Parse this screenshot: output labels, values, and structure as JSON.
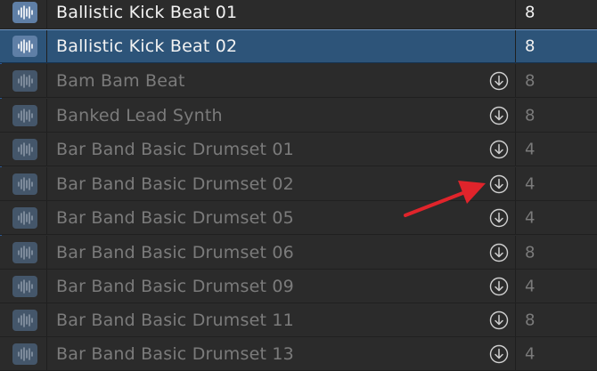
{
  "rows": [
    {
      "name": "Ballistic Kick Beat 01",
      "count": "8",
      "state": "installed",
      "selected": false
    },
    {
      "name": "Ballistic Kick Beat 02",
      "count": "8",
      "state": "installed",
      "selected": true
    },
    {
      "name": "Bam Bam Beat",
      "count": "8",
      "state": "missing",
      "selected": false
    },
    {
      "name": "Banked Lead Synth",
      "count": "8",
      "state": "missing",
      "selected": false
    },
    {
      "name": "Bar Band Basic Drumset 01",
      "count": "4",
      "state": "missing",
      "selected": false
    },
    {
      "name": "Bar Band Basic Drumset 02",
      "count": "4",
      "state": "missing",
      "selected": false
    },
    {
      "name": "Bar Band Basic Drumset 05",
      "count": "4",
      "state": "missing",
      "selected": false
    },
    {
      "name": "Bar Band Basic Drumset 06",
      "count": "8",
      "state": "missing",
      "selected": false
    },
    {
      "name": "Bar Band Basic Drumset 09",
      "count": "4",
      "state": "missing",
      "selected": false
    },
    {
      "name": "Bar Band Basic Drumset 11",
      "count": "8",
      "state": "missing",
      "selected": false
    },
    {
      "name": "Bar Band Basic Drumset 13",
      "count": "4",
      "state": "missing",
      "selected": false
    }
  ],
  "icons": {
    "row_icon": "audio-waveform-icon",
    "download": "download-arrow-circle-icon",
    "annotation": "red-arrow"
  },
  "colors": {
    "selected_row": "#2d5479",
    "annotation_arrow": "#e0242b"
  }
}
